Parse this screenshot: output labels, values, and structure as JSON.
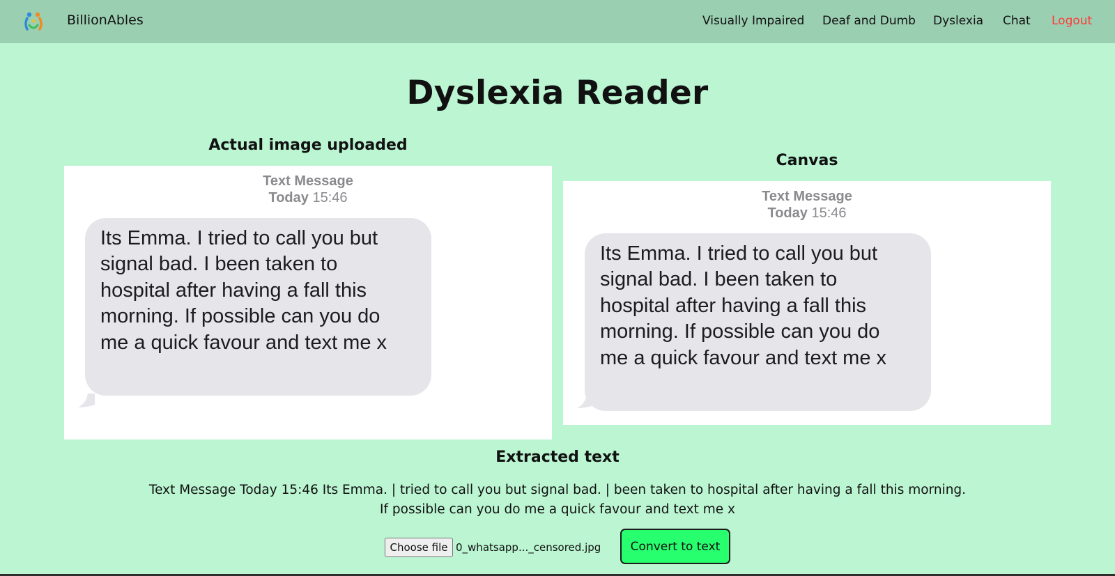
{
  "navbar": {
    "brand": "BillionAbles",
    "links": [
      "Visually Impaired",
      "Deaf and Dumb",
      "Dyslexia",
      "Chat"
    ],
    "logout": "Logout",
    "logout_color": "#ff3b3b"
  },
  "page": {
    "title": "Dyslexia Reader"
  },
  "uploaded": {
    "title": "Actual image uploaded"
  },
  "canvas": {
    "title": "Canvas"
  },
  "image_content": {
    "header": "Text Message",
    "day": "Today",
    "time": "15:46",
    "lines": [
      "Its Emma. I tried to call you but",
      "signal bad. I been taken to",
      "hospital after having a fall this",
      "morning. If possible can you do",
      "me a quick favour and text me x"
    ]
  },
  "extracted": {
    "heading": "Extracted text",
    "line1": "Text Message Today 15:46 Its Emma. | tried to call you but signal bad. | been taken to hospital after having a fall this morning.",
    "line2": "If possible can you do me a quick favour and text me x"
  },
  "controls": {
    "choose_file_label": "Choose file",
    "file_name": "0_whatsapp..._censored.jpg",
    "convert_label": "Convert to text",
    "convert_color": "#27ff6e"
  },
  "colors": {
    "background": "#bbf5d2",
    "navbar": "#9bcfb2",
    "bubble": "#e5e5ea"
  }
}
